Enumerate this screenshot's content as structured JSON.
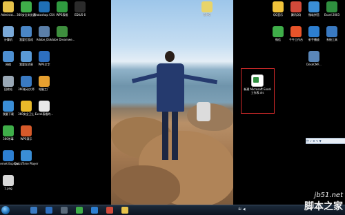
{
  "desktop_left": [
    {
      "label": "Administ...",
      "color": "#e6c24a"
    },
    {
      "label": "360安全浏览器",
      "color": "#3fae49"
    },
    {
      "label": "Photoshop CS4",
      "color": "#1f6fb5"
    },
    {
      "label": "WPS表格",
      "color": "#2f9a3f"
    },
    {
      "label": "EDIUS 6",
      "color": "#2b2b2b"
    },
    {
      "label": "计算机",
      "color": "#7aa9d8"
    },
    {
      "label": "我要打游戏",
      "color": "#4a86c6"
    },
    {
      "label": "Adobe_Di...",
      "color": "#5b7fa8"
    },
    {
      "label": "Adobe Dreamwe...",
      "color": "#3e8f3e"
    },
    {
      "label": "网络",
      "color": "#4d8fd1"
    },
    {
      "label": "我要发消息",
      "color": "#5a9ad6"
    },
    {
      "label": "WPS文字",
      "color": "#2d6fc0"
    },
    {
      "label": "回收站",
      "color": "#9aa8b6"
    },
    {
      "label": "360驱动大师",
      "color": "#3a7ac2"
    },
    {
      "label": "电脑工厂",
      "color": "#e6a030"
    },
    {
      "label": "我要下载",
      "color": "#3a8ed6"
    },
    {
      "label": "360安全卫士",
      "color": "#e8b92a"
    },
    {
      "label": "Excel表格的...",
      "color": "#e8e8e8"
    },
    {
      "label": "360杀毒",
      "color": "#3fae49"
    },
    {
      "label": "WPS演示",
      "color": "#d65a2a"
    },
    {
      "label": "Internet Explorer",
      "color": "#2d7fd1"
    },
    {
      "label": "QuickTime Player",
      "color": "#3a8ed6"
    },
    {
      "label": "1.png",
      "color": "#d8d8d8"
    }
  ],
  "desktop_right": [
    {
      "label": "QQ音乐",
      "color": "#f0c23a"
    },
    {
      "label": "腾讯QQ",
      "color": "#d24a3a"
    },
    {
      "label": "微软拼音",
      "color": "#3a8ed6"
    },
    {
      "label": "Excel 2003",
      "color": "#2f8f3f"
    },
    {
      "label": "微信",
      "color": "#3fae49"
    },
    {
      "label": "千牛工作台",
      "color": "#e8542a"
    },
    {
      "label": "射手播放",
      "color": "#2d7fd1"
    },
    {
      "label": "系统工具",
      "color": "#3a7ac2"
    },
    {
      "label": "DeskCMF...",
      "color": "#5a86b8"
    }
  ],
  "center_file": {
    "label": "GIMG"
  },
  "selected_file": {
    "label": "新建 Microsoft Excel 工作表.xls"
  },
  "langbar": {
    "text": "中 ♪ ⚙ ✎ ▼"
  },
  "taskbar": {
    "tray_text": "ㄓ ◀"
  },
  "watermark": {
    "site": "jb51.net",
    "name": "脚本之家"
  }
}
